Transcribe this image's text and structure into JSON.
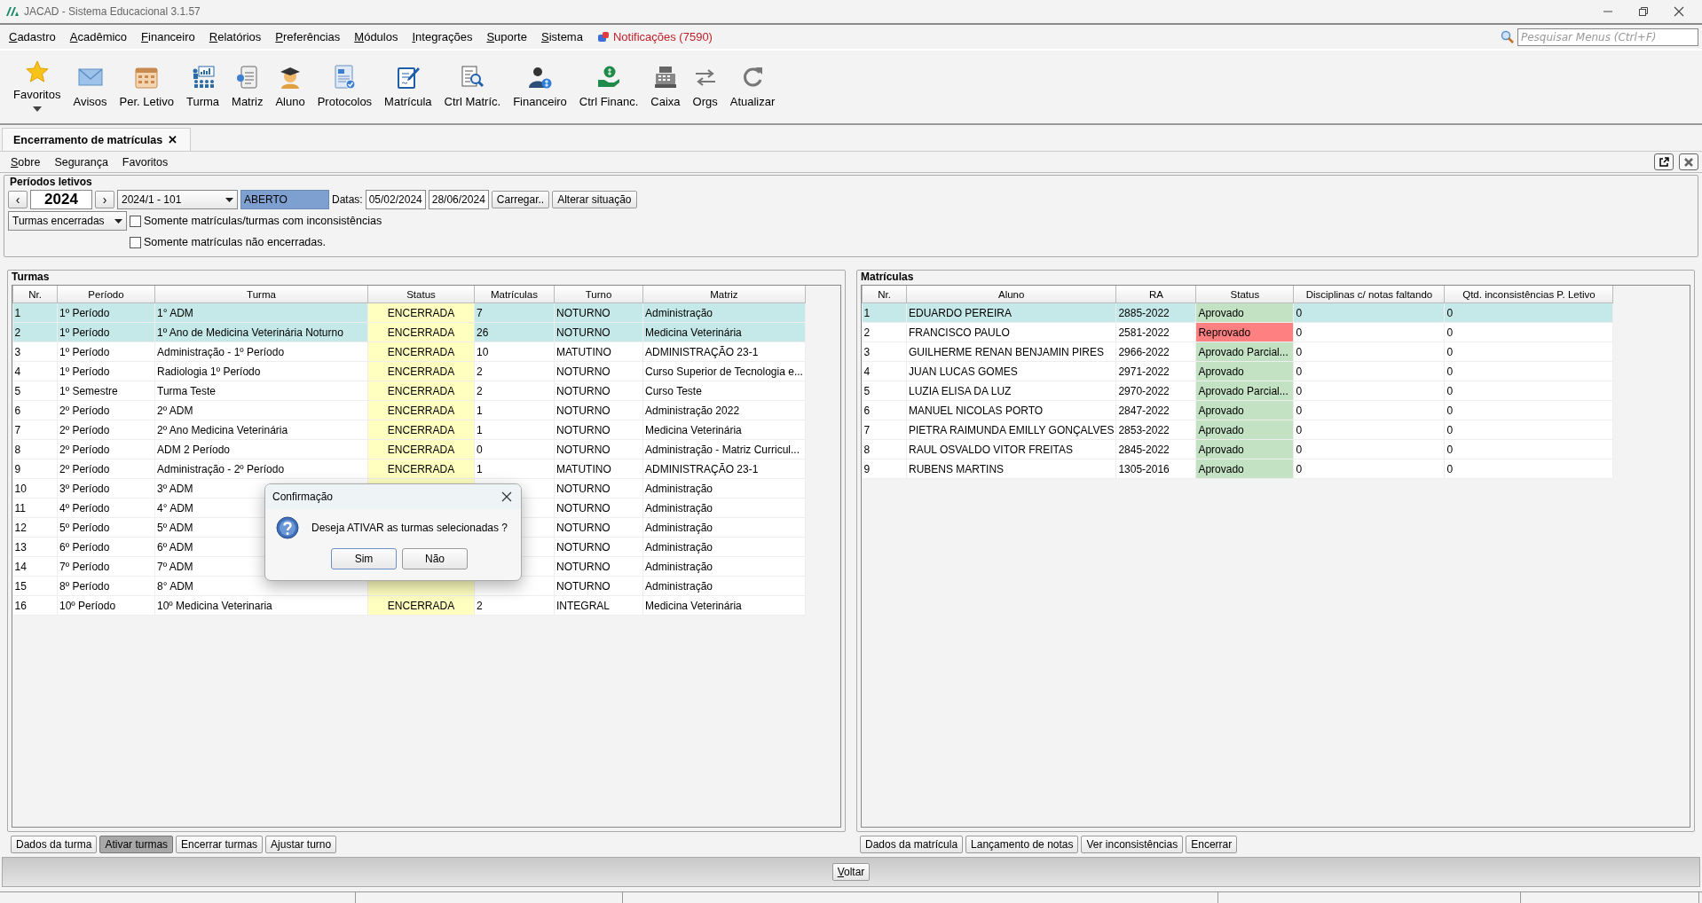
{
  "window": {
    "title": "JACAD - Sistema Educacional 3.1.57"
  },
  "menu": [
    {
      "label": "Cadastro"
    },
    {
      "label": "Acadêmico"
    },
    {
      "label": "Financeiro"
    },
    {
      "label": "Relatórios"
    },
    {
      "label": "Preferências"
    },
    {
      "label": "Módulos"
    },
    {
      "label": "Integrações"
    },
    {
      "label": "Suporte"
    },
    {
      "label": "Sistema"
    }
  ],
  "notifications": "Notificações (7590)",
  "search": {
    "placeholder": "Pesquisar Menus (Ctrl+F)"
  },
  "toolbar": [
    {
      "label": "Favoritos",
      "dropdown": true
    },
    {
      "label": "Avisos",
      "dropdown": false
    },
    {
      "label": "Per. Letivo",
      "dropdown": false
    },
    {
      "label": "Turma",
      "dropdown": false
    },
    {
      "label": "Matriz",
      "dropdown": false
    },
    {
      "label": "Aluno",
      "dropdown": false
    },
    {
      "label": "Protocolos",
      "dropdown": false
    },
    {
      "label": "Matrícula",
      "dropdown": false
    },
    {
      "label": "Ctrl Matríc.",
      "dropdown": false
    },
    {
      "label": "Financeiro",
      "dropdown": false
    },
    {
      "label": "Ctrl Financ.",
      "dropdown": false
    },
    {
      "label": "Caixa",
      "dropdown": false
    },
    {
      "label": "Orgs",
      "dropdown": false
    },
    {
      "label": "Atualizar",
      "dropdown": false
    }
  ],
  "tab": {
    "label": "Encerramento de matrículas",
    "close": "✕"
  },
  "submenu": [
    "Sobre",
    "Segurança",
    "Favoritos"
  ],
  "periodos": {
    "title": "Períodos letivos",
    "prev": "‹",
    "year": "2024",
    "next": "›",
    "periodo": "2024/1 - 101",
    "situacao": "ABERTO",
    "datas_label": "Datas:",
    "data_inicio": "05/02/2024",
    "data_fim": "28/06/2024",
    "buttons": [
      "Carregar..",
      "Alterar situação"
    ],
    "filtro": "Turmas encerradas",
    "checks": [
      {
        "label": "Somente matrículas/turmas com inconsistências",
        "checked": false
      },
      {
        "label": "Somente matrículas não encerradas.",
        "checked": false
      }
    ]
  },
  "turmas": {
    "title": "Turmas",
    "columns": [
      "Nr.",
      "Período",
      "Turma",
      "Status",
      "Matrículas",
      "Turno",
      "Matriz"
    ],
    "rows": [
      {
        "cells": [
          "1",
          "1º Período",
          "1° ADM",
          "ENCERRADA",
          "7",
          "NOTURNO",
          "Administração"
        ],
        "selected": true
      },
      {
        "cells": [
          "2",
          "1º Período",
          "1º Ano de Medicina Veterinária Noturno",
          "ENCERRADA",
          "26",
          "NOTURNO",
          "Medicina Veterinária"
        ],
        "selected": true
      },
      {
        "cells": [
          "3",
          "1º Período",
          "Administração - 1º Período",
          "ENCERRADA",
          "10",
          "MATUTINO",
          "ADMINISTRAÇÃO 23-1"
        ],
        "selected": false
      },
      {
        "cells": [
          "4",
          "1º Período",
          "Radiologia 1º Período",
          "ENCERRADA",
          "2",
          "NOTURNO",
          "Curso Superior de Tecnologia e..."
        ],
        "selected": false
      },
      {
        "cells": [
          "5",
          "1º Semestre",
          "Turma Teste",
          "ENCERRADA",
          "2",
          "NOTURNO",
          "Curso Teste"
        ],
        "selected": false
      },
      {
        "cells": [
          "6",
          "2º Período",
          "2º ADM",
          "ENCERRADA",
          "1",
          "NOTURNO",
          "Administração 2022"
        ],
        "selected": false
      },
      {
        "cells": [
          "7",
          "2º Período",
          "2º Ano Medicina Veterinária",
          "ENCERRADA",
          "1",
          "NOTURNO",
          "Medicina Veterinária"
        ],
        "selected": false
      },
      {
        "cells": [
          "8",
          "2º Período",
          "ADM 2 Período",
          "ENCERRADA",
          "0",
          "NOTURNO",
          "Administração - Matriz Curricul..."
        ],
        "selected": false
      },
      {
        "cells": [
          "9",
          "2º Período",
          "Administração - 2º Período",
          "ENCERRADA",
          "1",
          "MATUTINO",
          "ADMINISTRAÇÃO 23-1"
        ],
        "selected": false
      },
      {
        "cells": [
          "10",
          "3º Período",
          "3º ADM",
          null,
          null,
          "NOTURNO",
          "Administração"
        ],
        "selected": false
      },
      {
        "cells": [
          "11",
          "4º Período",
          "4° ADM",
          null,
          null,
          "NOTURNO",
          "Administração"
        ],
        "selected": false
      },
      {
        "cells": [
          "12",
          "5º Período",
          "5º ADM",
          null,
          null,
          "NOTURNO",
          "Administração"
        ],
        "selected": false
      },
      {
        "cells": [
          "13",
          "6º Período",
          "6º ADM",
          null,
          null,
          "NOTURNO",
          "Administração"
        ],
        "selected": false
      },
      {
        "cells": [
          "14",
          "7º Período",
          "7º ADM",
          null,
          null,
          "NOTURNO",
          "Administração"
        ],
        "selected": false
      },
      {
        "cells": [
          "15",
          "8º Período",
          "8° ADM",
          null,
          null,
          "NOTURNO",
          "Administração"
        ],
        "selected": false
      },
      {
        "cells": [
          "16",
          "10º Período",
          "10º  Medicina Veterinaria",
          "ENCERRADA",
          "2",
          "INTEGRAL",
          "Medicina Veterinária"
        ],
        "selected": false
      }
    ],
    "buttons": [
      {
        "label": "Dados da turma",
        "pressed": false
      },
      {
        "label": "Ativar turmas",
        "pressed": true
      },
      {
        "label": "Encerrar turmas",
        "pressed": false
      },
      {
        "label": "Ajustar turno",
        "pressed": false
      }
    ]
  },
  "matriculas": {
    "title": "Matrículas",
    "columns": [
      "Nr.",
      "Aluno",
      "RA",
      "Status",
      "Disciplinas c/ notas faltando",
      "Qtd. inconsistências P. Letivo"
    ],
    "rows": [
      {
        "cells": [
          "1",
          "EDUARDO PEREIRA",
          "2885-2022",
          "Aprovado",
          "0",
          "0"
        ],
        "selected": true,
        "color": "#c3e2c3"
      },
      {
        "cells": [
          "2",
          "FRANCISCO PAULO",
          "2581-2022",
          "Reprovado",
          "0",
          "0"
        ],
        "selected": false,
        "color": "#ff8080"
      },
      {
        "cells": [
          "3",
          "GUILHERME RENAN BENJAMIN PIRES",
          "2966-2022",
          "Aprovado Parcial...",
          "0",
          "0"
        ],
        "selected": false,
        "color": "#c3e2c3"
      },
      {
        "cells": [
          "4",
          "JUAN LUCAS GOMES",
          "2971-2022",
          "Aprovado",
          "0",
          "0"
        ],
        "selected": false,
        "color": "#c3e2c3"
      },
      {
        "cells": [
          "5",
          "LUZIA ELISA DA LUZ",
          "2970-2022",
          "Aprovado Parcial...",
          "0",
          "0"
        ],
        "selected": false,
        "color": "#c3e2c3"
      },
      {
        "cells": [
          "6",
          "MANUEL NICOLAS PORTO",
          "2847-2022",
          "Aprovado",
          "0",
          "0"
        ],
        "selected": false,
        "color": "#c3e2c3"
      },
      {
        "cells": [
          "7",
          "PIETRA RAIMUNDA EMILLY GONÇALVES",
          "2853-2022",
          "Aprovado",
          "0",
          "0"
        ],
        "selected": false,
        "color": "#c3e2c3"
      },
      {
        "cells": [
          "8",
          "RAUL OSVALDO VITOR FREITAS",
          "2845-2022",
          "Aprovado",
          "0",
          "0"
        ],
        "selected": false,
        "color": "#c3e2c3"
      },
      {
        "cells": [
          "9",
          "RUBENS MARTINS",
          "1305-2016",
          "Aprovado",
          "0",
          "0"
        ],
        "selected": false,
        "color": "#c3e2c3"
      }
    ],
    "buttons": [
      {
        "label": "Dados da matrícula",
        "pressed": false
      },
      {
        "label": "Lançamento de notas",
        "pressed": false
      },
      {
        "label": "Ver inconsistências",
        "pressed": false
      },
      {
        "label": "Encerrar",
        "pressed": false
      }
    ]
  },
  "voltar": "Voltar",
  "dialog": {
    "title": "Confirmação",
    "message": "Deseja ATIVAR as turmas selecionadas ?",
    "buttons": [
      {
        "label": "Sim",
        "default": true
      },
      {
        "label": "Não",
        "default": false
      }
    ]
  }
}
